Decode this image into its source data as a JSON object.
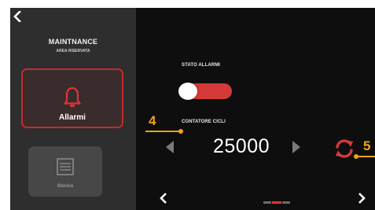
{
  "sidebar": {
    "title": "MAINTNANCE",
    "subtitle": "AREA RISERVATA",
    "tiles": [
      {
        "label": "Allarmi",
        "icon": "bell-icon",
        "active": true
      },
      {
        "label": "Storico",
        "icon": "history-list-icon",
        "active": false
      }
    ]
  },
  "main": {
    "alarm_status_label": "STATO ALLARMI",
    "alarm_status_on": true,
    "counter_label": "CONTATORE CICLI",
    "counter_value": "25000"
  },
  "pager": {
    "pages": 3,
    "current": 2
  },
  "annotations": [
    {
      "label": "4"
    },
    {
      "label": "5"
    }
  ],
  "colors": {
    "accent_red": "#d43a3a",
    "annotation_orange": "#f0a21a",
    "background": "#0e0e0e",
    "sidebar": "#2e2e2e"
  }
}
